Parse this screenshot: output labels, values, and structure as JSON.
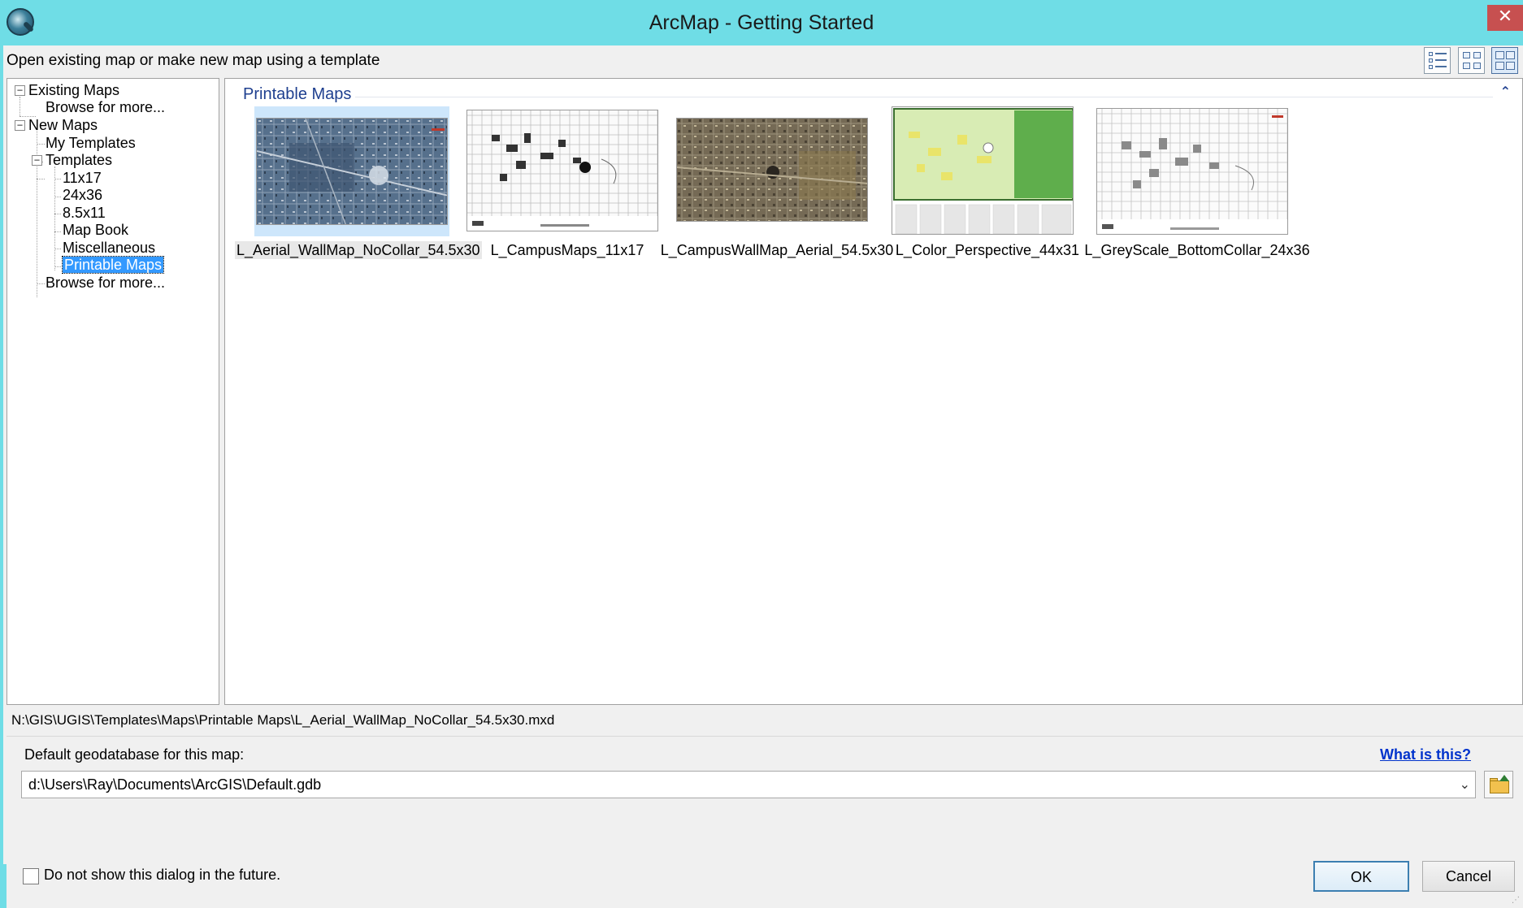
{
  "window": {
    "title": "ArcMap - Getting Started",
    "close_glyph": "✕",
    "icon": "arcmap-globe-icon"
  },
  "header": {
    "instruction": "Open existing map or make new map using a template",
    "view_buttons": [
      "details-view-icon",
      "small-thumbnails-view-icon",
      "large-thumbnails-view-icon"
    ]
  },
  "tree": {
    "existing_maps": "Existing Maps",
    "existing_browse": "Browse for more...",
    "new_maps": "New Maps",
    "my_templates": "My Templates",
    "templates": "Templates",
    "t_11x17": "11x17",
    "t_24x36": "24x36",
    "t_85x11": "8.5x11",
    "t_map_book": "Map Book",
    "t_misc": "Miscellaneous",
    "t_printable": "Printable Maps",
    "new_browse": "Browse for more...",
    "expander_minus": "−",
    "selected_item": "Printable Maps"
  },
  "content": {
    "group_title": "Printable Maps",
    "collapse_glyph": "⌃",
    "templates": [
      {
        "name": "L_Aerial_WallMap_NoCollar_54.5x30",
        "selected": true
      },
      {
        "name": "L_CampusMaps_11x17",
        "selected": false
      },
      {
        "name": "L_CampusWallMap_Aerial_54.5x30",
        "selected": false
      },
      {
        "name": "L_Color_Perspective_44x31",
        "selected": false
      },
      {
        "name": "L_GreyScale_BottomCollar_24x36",
        "selected": false
      }
    ]
  },
  "path_bar": {
    "path": "N:\\GIS\\UGIS\\Templates\\Maps\\Printable Maps\\L_Aerial_WallMap_NoCollar_54.5x30.mxd"
  },
  "geodatabase": {
    "label": "Default geodatabase for this map:",
    "help_link": "What is this?",
    "value": "d:\\Users\\Ray\\Documents\\ArcGIS\\Default.gdb",
    "dropdown_glyph": "⌄"
  },
  "footer": {
    "checkbox_label": "Do not show this dialog in the future.",
    "checkbox_checked": false,
    "ok_label": "OK",
    "cancel_label": "Cancel"
  },
  "colors": {
    "titlebar": "#6fdde6",
    "close_button": "#c75050",
    "selection": "#3399ff",
    "group_header": "#1e3f8f",
    "link": "#0033cc"
  }
}
